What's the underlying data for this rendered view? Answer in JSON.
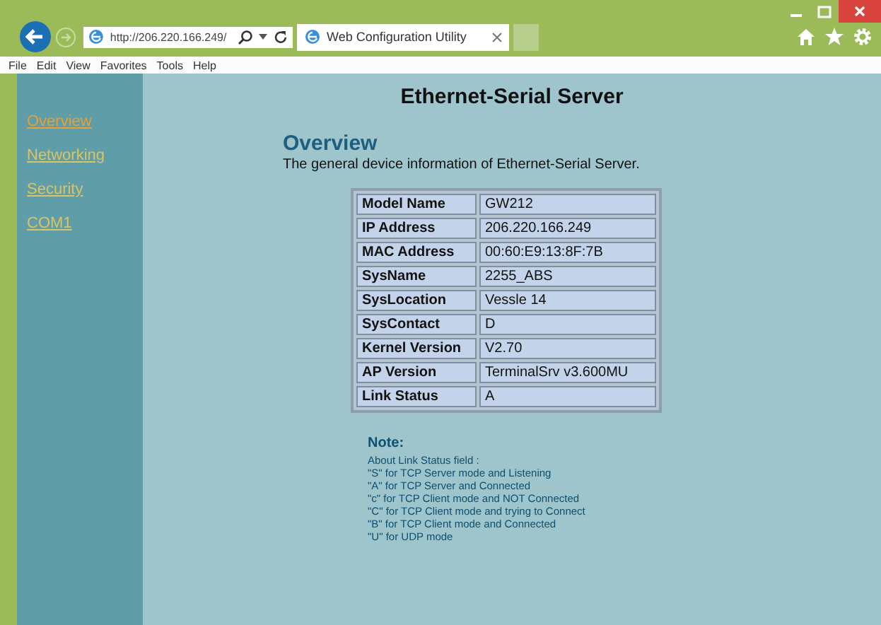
{
  "browser": {
    "address": "http://206.220.166.249/",
    "tabs": [
      {
        "title": "Web Configuration Utility",
        "selected": true
      }
    ],
    "menu": [
      "File",
      "Edit",
      "View",
      "Favorites",
      "Tools",
      "Help"
    ]
  },
  "page": {
    "title": "Ethernet-Serial Server",
    "sidebar": [
      {
        "label": "Overview",
        "selected": true
      },
      {
        "label": "Networking",
        "selected": false
      },
      {
        "label": "Security",
        "selected": false
      },
      {
        "label": "COM1",
        "selected": false
      }
    ],
    "heading": "Overview",
    "description": "The general device information of Ethernet-Serial Server.",
    "table": [
      {
        "label": "Model Name",
        "value": "GW212"
      },
      {
        "label": "IP Address",
        "value": "206.220.166.249"
      },
      {
        "label": "MAC Address",
        "value": "00:60:E9:13:8F:7B"
      },
      {
        "label": "SysName",
        "value": "2255_ABS"
      },
      {
        "label": "SysLocation",
        "value": "Vessle 14"
      },
      {
        "label": "SysContact",
        "value": "D"
      },
      {
        "label": "Kernel Version",
        "value": "V2.70"
      },
      {
        "label": "AP Version",
        "value": "TerminalSrv v3.600MU"
      },
      {
        "label": "Link Status",
        "value": "A"
      }
    ],
    "note": {
      "title": "Note:",
      "lines": [
        "About Link Status field :",
        "\"S\" for TCP Server mode and Listening",
        "\"A\" for TCP Server and Connected",
        "\"c\" for TCP Client mode and NOT Connected",
        "\"C\" for TCP Client mode and trying to Connect",
        "\"B\" for TCP Client mode and Connected",
        "\"U\" for UDP mode"
      ]
    }
  }
}
